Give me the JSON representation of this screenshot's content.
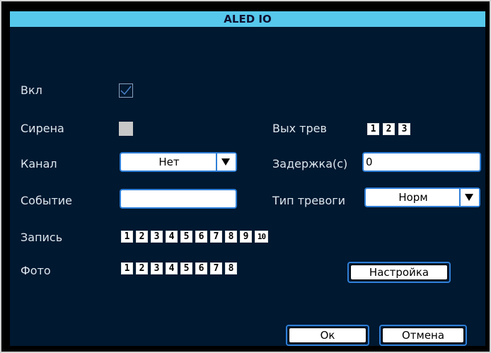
{
  "window": {
    "title": "ALED IO"
  },
  "form": {
    "enable": {
      "label": "Вкл",
      "checked": true
    },
    "siren": {
      "label": "Сирена",
      "checked": false
    },
    "alarm_out": {
      "label": "Вых трев",
      "buttons": [
        "1",
        "2",
        "3"
      ]
    },
    "channel": {
      "label": "Канал",
      "value": "Нет"
    },
    "delay": {
      "label": "Задержка(с)",
      "value": "0"
    },
    "event": {
      "label": "Событие",
      "value": ""
    },
    "alarm_type": {
      "label": "Тип тревоги",
      "value": "Норм"
    },
    "record": {
      "label": "Запись",
      "buttons": [
        "1",
        "2",
        "3",
        "4",
        "5",
        "6",
        "7",
        "8",
        "9",
        "10"
      ]
    },
    "photo": {
      "label": "Фото",
      "buttons": [
        "1",
        "2",
        "3",
        "4",
        "5",
        "6",
        "7",
        "8"
      ]
    },
    "settings_button": "Настройка"
  },
  "footer": {
    "ok": "Ок",
    "cancel": "Отмена"
  },
  "colors": {
    "title_bar": "#56c8ec",
    "background": "#001830",
    "accent": "#2f7fd8",
    "label_text": "#dde6ee"
  },
  "icons": {
    "checkbox_check": "check-icon",
    "dropdown": "triangle-down-icon"
  }
}
